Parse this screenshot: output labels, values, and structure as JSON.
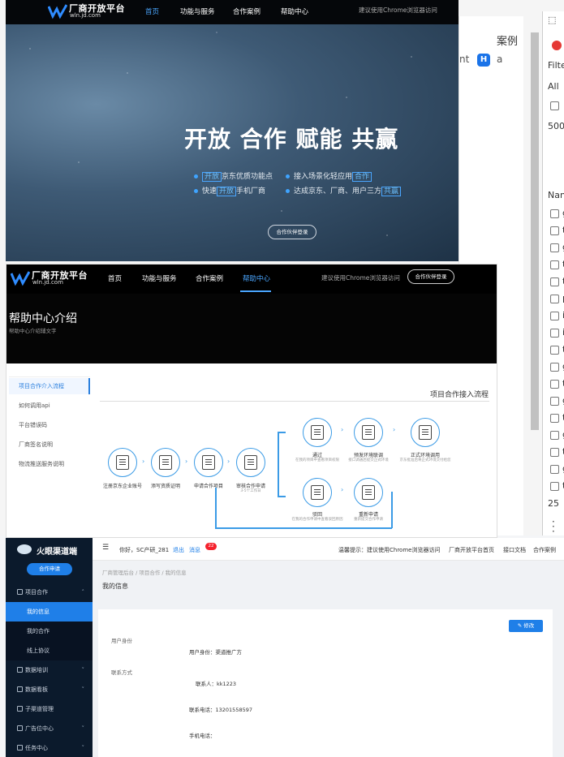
{
  "background": {
    "case_text": "案例",
    "nt_text": "nt",
    "h_badge": "H",
    "a_text": "a",
    "pct_text": "25"
  },
  "devtools": {
    "filter": "Filte",
    "all": "All",
    "count": "500",
    "name_col": "Nan",
    "row_letters": [
      "g",
      "t",
      "g",
      "t",
      "t",
      "p",
      "i",
      "i",
      "t",
      "g",
      "t",
      "g",
      "t",
      "g",
      "t",
      "g",
      "t"
    ],
    "bottom": "25"
  },
  "panel_a": {
    "logo_main": "厂商开放平台",
    "logo_sub": "wln.jd.com",
    "nav": [
      "首页",
      "功能与服务",
      "合作案例",
      "帮助中心"
    ],
    "active_nav": 0,
    "hint": "建议使用Chrome浏览器访问",
    "hero": "开放 合作 赋能 共赢",
    "features": [
      {
        "pre": "",
        "hl": "开放",
        "post": "京东优质功能点"
      },
      {
        "pre": "接入场景化轻应用",
        "hl": "合作",
        "post": ""
      },
      {
        "pre": "快速",
        "hl": "开放",
        "post": "手机厂商"
      },
      {
        "pre": "达成京东、厂商、用户三方",
        "hl": "共赢",
        "post": ""
      }
    ],
    "button": "合作伙伴登录"
  },
  "panel_b": {
    "logo_main": "厂商开放平台",
    "logo_sub": "wln.jd.com",
    "nav": [
      "首页",
      "功能与服务",
      "合作案例",
      "帮助中心"
    ],
    "active_nav": 3,
    "hint": "建议使用Chrome浏览器访问",
    "button": "合作伙伴登录",
    "title": "帮助中心介绍",
    "subtitle": "帮助中心介绍辅文字",
    "sidebar": [
      "项目合作介入流程",
      "如何调用api",
      "平台错误码",
      "厂商签名说明",
      "物流推送服务说明"
    ],
    "active_side": 0,
    "flow_title": "项目合作接入流程",
    "nodes": [
      {
        "label": "注册京东企业账号",
        "sub": ""
      },
      {
        "label": "添写资质证明",
        "sub": ""
      },
      {
        "label": "申请合作项目",
        "sub": ""
      },
      {
        "label": "审核合作申请",
        "sub": "3-5个工作日"
      },
      {
        "label": "通过",
        "sub": "在我的项目中查看项目权限"
      },
      {
        "label": "预发环境联调",
        "sub": "接口调通后提交正式环境"
      },
      {
        "label": "正式环境调用",
        "sub": "京东批准后将正式环境交付给您"
      },
      {
        "label": "驳回",
        "sub": "在我的合作申请中查看驳回原因"
      },
      {
        "label": "重新申请",
        "sub": "重新提交合作申请"
      }
    ]
  },
  "panel_c": {
    "logo": "火眼渠道端",
    "apply_button": "合作申请",
    "menu": [
      {
        "label": "项目合作",
        "type": "group",
        "chev": "˄"
      },
      {
        "label": "我的信息",
        "type": "sub",
        "active": true
      },
      {
        "label": "我的合作",
        "type": "sub"
      },
      {
        "label": "线上协议",
        "type": "sub"
      },
      {
        "label": "数据培训",
        "type": "group",
        "chev": "˅"
      },
      {
        "label": "数据看板",
        "type": "group",
        "chev": "˅"
      },
      {
        "label": "子渠道管理",
        "type": "group",
        "chev": ""
      },
      {
        "label": "广告位中心",
        "type": "group",
        "chev": "˅"
      },
      {
        "label": "任务中心",
        "type": "group",
        "chev": "˅"
      }
    ],
    "greeting": "你好，SC产研_281",
    "logout": "退出",
    "messages": "消息",
    "msg_count": "22",
    "tip": "温馨提示：建议使用Chrome浏览器访问",
    "links": [
      "厂商开放平台首页",
      "接口文档",
      "合作案例"
    ],
    "breadcrumb": [
      "厂商管理后台",
      "项目合作",
      "我的信息"
    ],
    "page_title": "我的信息",
    "edit_button": "修改",
    "section_user": "用户身份",
    "user_identity": "用户身份：渠道推广方",
    "section_contact": "联系方式",
    "contact_name": "联系人：kk1223",
    "contact_phone": "联系电话：13201558597",
    "mobile": "手机电话："
  }
}
